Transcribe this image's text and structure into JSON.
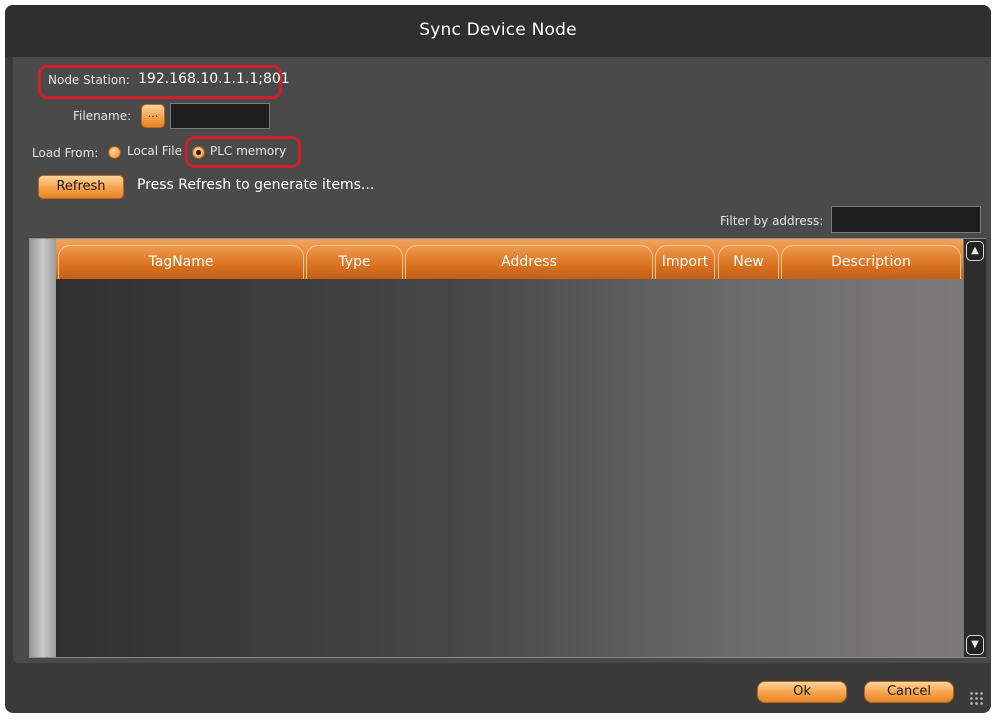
{
  "window": {
    "title": "Sync Device Node"
  },
  "form": {
    "node_station_label": "Node Station:",
    "node_station_value": "192.168.10.1.1.1;801",
    "filename_label": "Filename:",
    "browse_label": "...",
    "filename_value": "",
    "load_from_label": "Load From:",
    "load_options": [
      {
        "label": "Local File",
        "selected": false
      },
      {
        "label": "PLC memory",
        "selected": true
      }
    ],
    "refresh_label": "Refresh",
    "refresh_hint": "Press Refresh to generate items...",
    "filter_label": "Filter by address:",
    "filter_value": ""
  },
  "table": {
    "columns": [
      "TagName",
      "Type",
      "Address",
      "Import",
      "New",
      "Description"
    ],
    "rows": []
  },
  "scrollbar": {
    "up_icon": "arrow-up-icon",
    "down_icon": "arrow-down-icon"
  },
  "footer": {
    "ok_label": "Ok",
    "cancel_label": "Cancel"
  },
  "colors": {
    "accent": "#e8893a",
    "highlight": "#d01f2a",
    "background": "#3a3a3a"
  }
}
